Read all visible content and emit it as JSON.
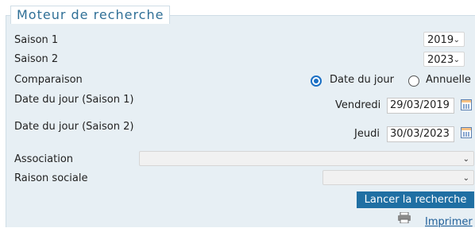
{
  "panel": {
    "title": "Moteur de recherche"
  },
  "fields": {
    "saison1": {
      "label": "Saison 1",
      "value": "2019"
    },
    "saison2": {
      "label": "Saison 2",
      "value": "2023"
    },
    "comparaison": {
      "label": "Comparaison",
      "options": [
        "Date du jour",
        "Annuelle"
      ],
      "selected": "Date du jour"
    },
    "date1": {
      "label": "Date du jour (Saison 1)",
      "day": "Vendredi",
      "value": "29/03/2019"
    },
    "date2": {
      "label": "Date du jour (Saison 2)",
      "day": "Jeudi",
      "value": "30/03/2023"
    },
    "association": {
      "label": "Association",
      "value": ""
    },
    "raison": {
      "label": "Raison sociale",
      "value": ""
    }
  },
  "actions": {
    "search_label": "Lancer la recherche",
    "print_label": "Imprimer"
  },
  "colors": {
    "accent": "#1f6fa3",
    "panel_bg": "#e7eff4",
    "legend_text": "#2f6f96"
  }
}
